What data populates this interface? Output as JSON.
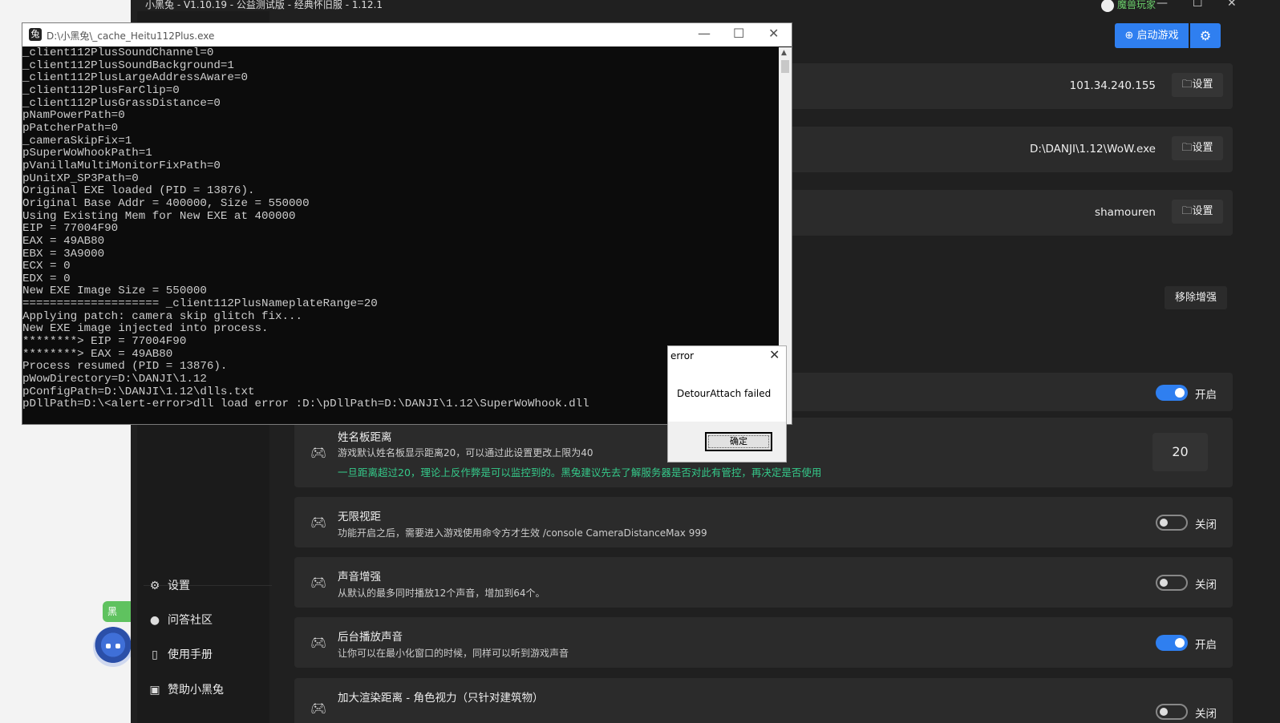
{
  "desktop": {
    "bubble_text": "黑"
  },
  "app": {
    "title": "小黑兔 - V1.10.19 - 公益测试版 - 经典怀旧服 - 1.12.1",
    "user": "魔兽玩家",
    "launch_label": "启动游戏",
    "sidebar": [
      {
        "icon": "gear",
        "label": "设置"
      },
      {
        "icon": "chat",
        "label": "问答社区"
      },
      {
        "icon": "book",
        "label": "使用手册"
      },
      {
        "icon": "gift",
        "label": "赞助小黑兔"
      }
    ],
    "settings_rows": [
      {
        "value": "101.34.240.155",
        "button": "设置"
      },
      {
        "value": "D:\\DANJI\\1.12\\WoW.exe",
        "button": "设置"
      },
      {
        "value": "shamouren",
        "button": "设置"
      }
    ],
    "remove_label": "移除增强",
    "toggle_row_label": "开启",
    "features": [
      {
        "title": "姓名板距离",
        "desc": "游戏默认姓名板显示距离20，可以通过此设置更改上限为40",
        "warn": "一旦距离超过20，理论上反作弊是可以监控到的。黑兔建议先去了解服务器是否对此有管控，再决定是否使用",
        "value": "20"
      },
      {
        "title": "无限视距",
        "desc": "功能开启之后，需要进入游戏使用命令方才生效    /console CameraDistanceMax 999",
        "state": "关闭"
      },
      {
        "title": "声音增强",
        "desc": "从默认的最多同时播放12个声音，增加到64个。",
        "state": "关闭"
      },
      {
        "title": "后台播放声音",
        "desc": "让你可以在最小化窗口的时候，同样可以听到游戏声音",
        "state": "开启"
      },
      {
        "title": "加大渲染距离 - 角色视力（只针对建筑物）",
        "state": "关闭"
      }
    ]
  },
  "console": {
    "title": "D:\\小黑兔\\_cache_Heitu112Plus.exe",
    "lines": [
      "_client112PlusSoundChannel=0",
      "_client112PlusSoundBackground=1",
      "_client112PlusLargeAddressAware=0",
      "_client112PlusFarClip=0",
      "_client112PlusGrassDistance=0",
      "pNamPowerPath=0",
      "pPatcherPath=0",
      "_cameraSkipFix=1",
      "pSuperWoWhookPath=1",
      "pVanillaMultiMonitorFixPath=0",
      "pUnitXP_SP3Path=0",
      "Original EXE loaded (PID = 13876).",
      "Original Base Addr = 400000, Size = 550000",
      "Using Existing Mem for New EXE at 400000",
      "EIP = 77004F90",
      "EAX = 49AB80",
      "EBX = 3A9000",
      "ECX = 0",
      "EDX = 0",
      "New EXE Image Size = 550000",
      "==================== _client112PlusNameplateRange=20",
      "Applying patch: camera skip glitch fix...",
      "New EXE image injected into process.",
      "********> EIP = 77004F90",
      "********> EAX = 49AB80",
      "Process resumed (PID = 13876).",
      "pWowDirectory=D:\\DANJI\\1.12",
      "pConfigPath=D:\\DANJI\\1.12\\dlls.txt",
      "pDllPath=D:\\<alert-error>dll load error :D:\\pDllPath=D:\\DANJI\\1.12\\SuperWoWhook.dll"
    ]
  },
  "error_dialog": {
    "title": "error",
    "message": "DetourAttach failed",
    "ok_label": "确定"
  }
}
